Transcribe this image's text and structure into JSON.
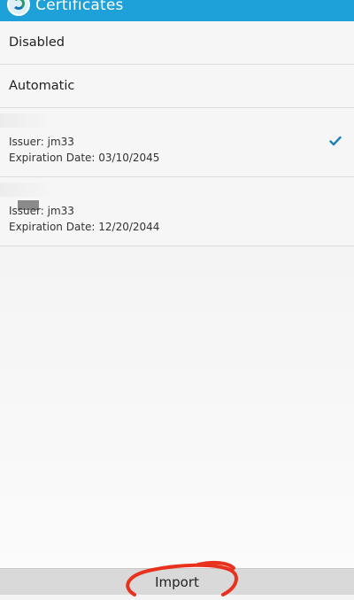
{
  "header": {
    "title": "Certificates",
    "logo_icon": "app-logo-icon",
    "color": "#1ea0d8"
  },
  "options": [
    {
      "label": "Disabled"
    },
    {
      "label": "Automatic"
    }
  ],
  "certificates": [
    {
      "issuer": "Issuer: jm33",
      "expiration": "Expiration Date: 03/10/2045",
      "selected": true
    },
    {
      "issuer": "Issuer: jm33",
      "expiration": "Expiration Date: 12/20/2044",
      "selected": false
    }
  ],
  "bottom_bar": {
    "import_label": "Import"
  },
  "colors": {
    "accent": "#1e7fb8",
    "annotation": "#e8321e"
  },
  "icons": {
    "check": "checkmark-icon"
  }
}
